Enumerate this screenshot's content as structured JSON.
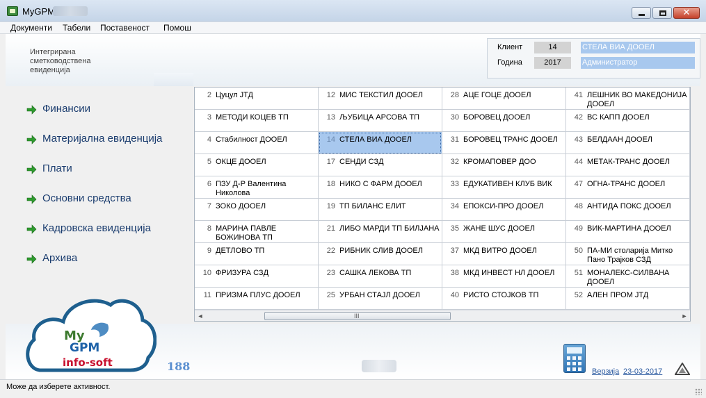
{
  "window": {
    "title": "MyGPM",
    "min_glyph": "–",
    "max_glyph": "□",
    "close_glyph": "✕"
  },
  "menu": [
    "Документи",
    "Табели",
    "Поставеност",
    "Помош"
  ],
  "header": {
    "app_description": "Интегрирана\nсметководствена\nевиденција",
    "client_label": "Клиент",
    "client_number": "14",
    "client_name": "СТЕЛА ВИА ДООЕЛ",
    "year_label": "Година",
    "year": "2017",
    "user_role": "Администратор"
  },
  "sidebar": {
    "items": [
      {
        "label": "Финансии",
        "icon": "green-arrow-icon"
      },
      {
        "label": "Материјална евиденција",
        "icon": "green-arrow-icon"
      },
      {
        "label": "Плати",
        "icon": "green-arrow-icon"
      },
      {
        "label": "Основни средства",
        "icon": "green-arrow-icon"
      },
      {
        "label": "Кадровска евиденција",
        "icon": "green-arrow-icon"
      },
      {
        "label": "Архива",
        "icon": "green-arrow-icon"
      }
    ]
  },
  "clients": {
    "selected_number": "14",
    "columns": [
      [
        {
          "num": "2",
          "name": "Цуцул ЈТД"
        },
        {
          "num": "3",
          "name": "МЕТОДИ КОЦЕВ ТП"
        },
        {
          "num": "4",
          "name": "Стабилност ДООЕЛ"
        },
        {
          "num": "5",
          "name": "ОКЦЕ ДООЕЛ"
        },
        {
          "num": "6",
          "name": "ПЗУ Д-Р Валентина Николова"
        },
        {
          "num": "7",
          "name": "ЗОКО ДООЕЛ"
        },
        {
          "num": "8",
          "name": "МАРИНА ПАВЛЕ БОЖИНОВА ТП"
        },
        {
          "num": "9",
          "name": "ДЕТЛОВО ТП"
        },
        {
          "num": "10",
          "name": "ФРИЗУРА СЗД"
        },
        {
          "num": "11",
          "name": "ПРИЗМА ПЛУС ДООЕЛ"
        }
      ],
      [
        {
          "num": "12",
          "name": "МИС ТЕКСТИЛ ДООЕЛ"
        },
        {
          "num": "13",
          "name": "ЉУБИЦА АРСОВА ТП"
        },
        {
          "num": "14",
          "name": "СТЕЛА ВИА ДООЕЛ"
        },
        {
          "num": "17",
          "name": "СЕНДИ СЗД"
        },
        {
          "num": "18",
          "name": "НИКО С ФАРМ ДООЕЛ"
        },
        {
          "num": "19",
          "name": "ТП БИЛАНС ЕЛИТ"
        },
        {
          "num": "21",
          "name": "ЛИБО МАРДИ ТП БИЛЈАНА"
        },
        {
          "num": "22",
          "name": "РИБНИК СЛИВ ДООЕЛ"
        },
        {
          "num": "23",
          "name": "САШКА ЛЕКОВА ТП"
        },
        {
          "num": "25",
          "name": "УРБАН СТАЈЛ ДООЕЛ"
        }
      ],
      [
        {
          "num": "28",
          "name": "АЦЕ ГОЦЕ ДООЕЛ"
        },
        {
          "num": "30",
          "name": "БОРОВЕЦ ДООЕЛ"
        },
        {
          "num": "31",
          "name": "БОРОВЕЦ ТРАНС ДООЕЛ"
        },
        {
          "num": "32",
          "name": "КРОМАПОВЕР ДОО"
        },
        {
          "num": "33",
          "name": "ЕДУКАТИВЕН КЛУБ ВИК"
        },
        {
          "num": "34",
          "name": "ЕПОКСИ-ПРО ДООЕЛ"
        },
        {
          "num": "35",
          "name": "ЖАНЕ ШУС ДООЕЛ"
        },
        {
          "num": "37",
          "name": "МКД ВИТРО ДООЕЛ"
        },
        {
          "num": "38",
          "name": "МКД ИНВЕСТ НЛ ДООЕЛ"
        },
        {
          "num": "40",
          "name": "РИСТО СТОЈКОВ ТП"
        }
      ],
      [
        {
          "num": "41",
          "name": "ЛЕШНИК ВО МАКЕДОНИЈА ДООЕЛ"
        },
        {
          "num": "42",
          "name": "ВС КАПП ДООЕЛ"
        },
        {
          "num": "43",
          "name": "БЕЛДААН ДООЕЛ"
        },
        {
          "num": "44",
          "name": "МЕТАК-ТРАНС ДООЕЛ"
        },
        {
          "num": "47",
          "name": "ОГНА-ТРАНС ДООЕЛ"
        },
        {
          "num": "48",
          "name": "АНТИДА ПОКС ДООЕЛ"
        },
        {
          "num": "49",
          "name": "ВИК-МАРТИНА ДООЕЛ"
        },
        {
          "num": "50",
          "name": "ПА-МИ столарија Митко Пано Трајков СЗД"
        },
        {
          "num": "51",
          "name": "МОНАЛЕКС-СИЛВАНА ДООЕЛ"
        },
        {
          "num": "52",
          "name": "АЛЕН ПРОМ ЈТД"
        }
      ]
    ],
    "scroll_left": "◄",
    "scroll_right": "►",
    "scroll_grip": "III"
  },
  "logo": {
    "my": "My",
    "gpm": "GPM",
    "company": "info-soft"
  },
  "footer": {
    "count": "188",
    "version_label": "Верзија",
    "version_date": "23-03-2017"
  },
  "status": {
    "message": "Може да изберете активност."
  },
  "colors": {
    "selection": "#a8c8ee",
    "nav_text": "#1a3c6e",
    "arrow_green": "#2e9a2e",
    "count_blue": "#5a8fd0",
    "link_blue": "#2b5aa0"
  }
}
